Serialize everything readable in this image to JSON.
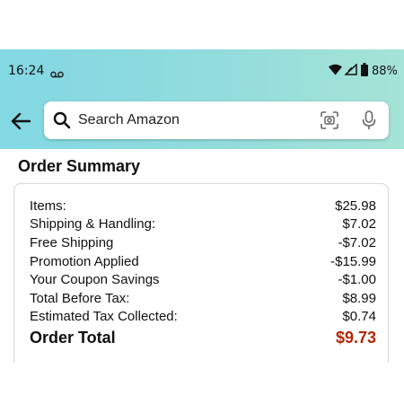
{
  "status_bar": {
    "time": "16:24",
    "battery": "88%",
    "icons": [
      "voicemail-icon",
      "wifi-icon",
      "signal-icon",
      "battery-icon"
    ]
  },
  "header": {
    "back_icon": "arrow-left-icon",
    "search": {
      "placeholder": "Search Amazon",
      "value": "",
      "icons": [
        "search-icon",
        "camera-icon",
        "mic-icon"
      ]
    }
  },
  "order_summary": {
    "title": "Order Summary",
    "rows": [
      {
        "label": "Items:",
        "value": "$25.98"
      },
      {
        "label": "Shipping & Handling:",
        "value": "$7.02"
      },
      {
        "label": "Free Shipping",
        "value": "-$7.02"
      },
      {
        "label": "Promotion Applied",
        "value": "-$15.99"
      },
      {
        "label": "Your Coupon Savings",
        "value": "-$1.00"
      },
      {
        "label": "Total Before Tax:",
        "value": "$8.99"
      },
      {
        "label": "Estimated Tax Collected:",
        "value": "$0.74"
      }
    ],
    "total": {
      "label": "Order Total",
      "value": "$9.73"
    }
  },
  "colors": {
    "header_gradient_start": "#82d8e3",
    "header_gradient_end": "#a5e4d6",
    "total_price": "#b12704",
    "text": "#0f1111",
    "card_border": "#d5d9d9"
  }
}
